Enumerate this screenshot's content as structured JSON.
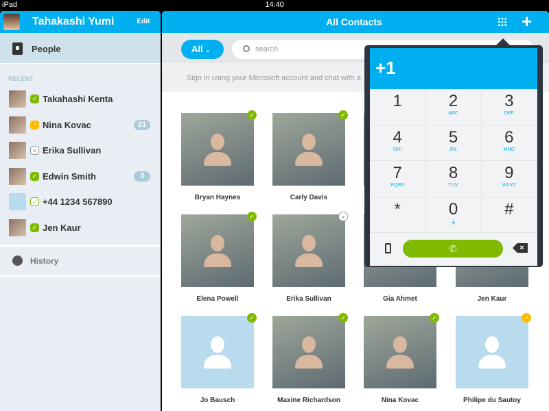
{
  "status_bar": {
    "device": "iPad",
    "time": "14:40"
  },
  "sidebar": {
    "user_name": "Tahakashi Yumi",
    "edit_label": "Edit",
    "people_label": "People",
    "recent_label": "RECENT",
    "recent": [
      {
        "name": "Takahashi Kenta",
        "status": "online",
        "badge": ""
      },
      {
        "name": "Nina Kovac",
        "status": "away",
        "badge": "21"
      },
      {
        "name": "Erika Sullivan",
        "status": "offline",
        "badge": ""
      },
      {
        "name": "Edwin Smith",
        "status": "online",
        "badge": "3"
      },
      {
        "name": "+44 1234 567890",
        "status": "phone",
        "badge": ""
      },
      {
        "name": "Jen Kaur",
        "status": "online",
        "badge": ""
      }
    ],
    "history_label": "History"
  },
  "main": {
    "title": "All Contacts",
    "filter": "All",
    "search_placeholder": "search",
    "sign_in_text": "Sign in using your Microsoft account and chat with a",
    "contacts": [
      {
        "name": "Bryan Haynes",
        "status": "online",
        "photo": true
      },
      {
        "name": "Carly Davis",
        "status": "online",
        "photo": true
      },
      {
        "name": "",
        "status": "online",
        "photo": true
      },
      {
        "name": "",
        "status": "",
        "photo": true
      },
      {
        "name": "Elena Powell",
        "status": "online",
        "photo": true
      },
      {
        "name": "Erika Sullivan",
        "status": "offline",
        "photo": true
      },
      {
        "name": "Gia Ahmet",
        "status": "",
        "photo": true
      },
      {
        "name": "Jen Kaur",
        "status": "",
        "photo": true
      },
      {
        "name": "Jo Bausch",
        "status": "online",
        "photo": false
      },
      {
        "name": "Maxine Richardson",
        "status": "online",
        "photo": true
      },
      {
        "name": "Nina Kovac",
        "status": "online",
        "photo": true
      },
      {
        "name": "Philipe du Sautoy",
        "status": "away",
        "photo": false
      }
    ]
  },
  "dialpad": {
    "display": "+1",
    "keys": [
      {
        "digit": "1",
        "sub": ""
      },
      {
        "digit": "2",
        "sub": "ABC"
      },
      {
        "digit": "3",
        "sub": "DEF"
      },
      {
        "digit": "4",
        "sub": "GHI"
      },
      {
        "digit": "5",
        "sub": "JKL"
      },
      {
        "digit": "6",
        "sub": "MNO"
      },
      {
        "digit": "7",
        "sub": "PQRS"
      },
      {
        "digit": "8",
        "sub": "TUV"
      },
      {
        "digit": "9",
        "sub": "WXYZ"
      },
      {
        "digit": "*",
        "sub": ""
      },
      {
        "digit": "0",
        "sub": "+"
      },
      {
        "digit": "#",
        "sub": ""
      }
    ]
  },
  "colors": {
    "accent": "#00aff0",
    "online": "#7fba00",
    "away": "#ffbb00"
  }
}
